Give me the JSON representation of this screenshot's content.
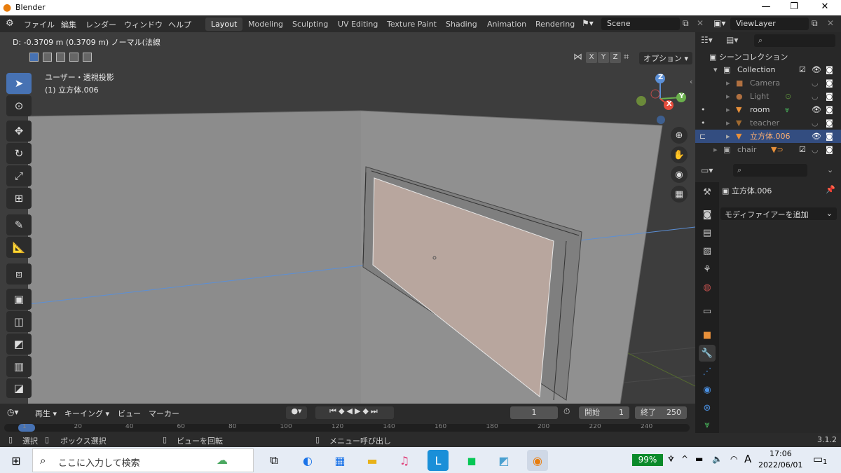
{
  "window": {
    "title": "Blender",
    "minimize": "—",
    "maximize": "❐",
    "close": "✕"
  },
  "menu": [
    "ファイル",
    "編集",
    "レンダー",
    "ウィンドウ",
    "ヘルプ"
  ],
  "workspaces": [
    "Layout",
    "Modeling",
    "Sculpting",
    "UV Editing",
    "Texture Paint",
    "Shading",
    "Animation",
    "Rendering"
  ],
  "scene": {
    "name": "Scene",
    "viewlayer": "ViewLayer"
  },
  "viewport": {
    "operator_info": "D: -0.3709 m (0.3709 m) ノーマル(法線",
    "view_name": "ユーザー・透視投影",
    "object_info": "(1) 立方体.006",
    "options_label": "オプション",
    "axes": [
      "X",
      "Y",
      "Z"
    ],
    "gizmo": {
      "z": "Z",
      "y": "Y",
      "x": "X"
    }
  },
  "outliner": {
    "scene_collection": "シーンコレクション",
    "rows": [
      {
        "name": "Collection",
        "dim": false
      },
      {
        "name": "Camera",
        "dim": true
      },
      {
        "name": "Light",
        "dim": true
      },
      {
        "name": "room",
        "dim": false
      },
      {
        "name": "teacher",
        "dim": true
      },
      {
        "name": "立方体.006",
        "dim": false
      },
      {
        "name": "chair",
        "dim": true
      }
    ]
  },
  "properties": {
    "object_name": "立方体.006",
    "add_modifier": "モディファイアーを追加"
  },
  "timeline": {
    "playback": "再生",
    "keying": "キーイング",
    "view": "ビュー",
    "marker": "マーカー",
    "current_frame": "1",
    "start_label": "開始",
    "start": "1",
    "end_label": "終了",
    "end": "250",
    "ruler": [
      "1",
      "20",
      "40",
      "60",
      "80",
      "100",
      "120",
      "140",
      "160",
      "180",
      "200",
      "220",
      "240"
    ]
  },
  "statusbar": {
    "select": "選択",
    "box_select": "ボックス選択",
    "rotate_view": "ビューを回転",
    "call_menu": "メニュー呼び出し",
    "version": "3.1.2"
  },
  "taskbar": {
    "search_placeholder": "ここに入力して検索",
    "battery": "99%",
    "ime": "A",
    "time": "17:06",
    "date": "2022/06/01",
    "notifications": "1"
  }
}
